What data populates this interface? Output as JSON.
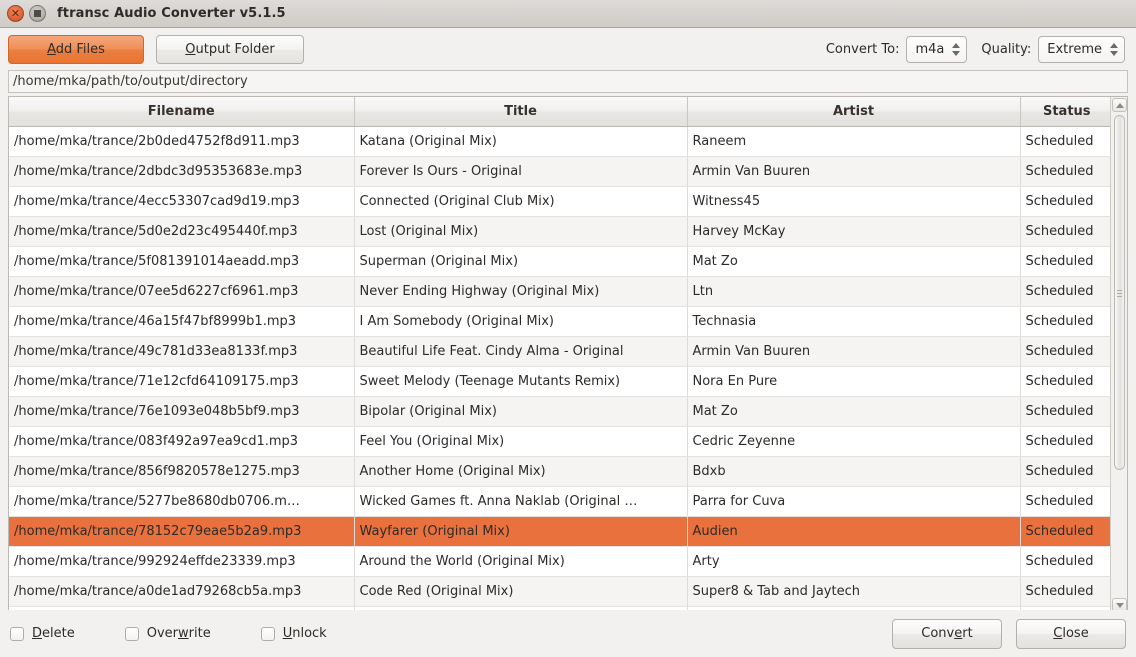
{
  "window": {
    "title": "ftransc Audio Converter v5.1.5",
    "close_icon": "close-icon",
    "maximize_icon": "maximize-icon"
  },
  "toolbar": {
    "add_files": {
      "pre": "A",
      "mnemonic": "A",
      "label": "Add Files",
      "before": "",
      "after": "dd Files"
    },
    "add_files_label": "Add Files",
    "output_folder_label": "Output Folder",
    "convert_to_label": "Convert To:",
    "format_value": "m4a",
    "quality_label": "Quality:",
    "quality_value": "Extreme"
  },
  "path_entry": {
    "value": "/home/mka/path/to/output/directory"
  },
  "table": {
    "columns": [
      "Filename",
      "Title",
      "Artist",
      "Status"
    ],
    "rows": [
      {
        "filename": "/home/mka/trance/2b0ded4752f8d911.mp3",
        "title": "Katana (Original Mix)",
        "artist": "Raneem",
        "status": "Scheduled"
      },
      {
        "filename": "/home/mka/trance/2dbdc3d95353683e.mp3",
        "title": "Forever Is Ours - Original",
        "artist": "Armin Van Buuren",
        "status": "Scheduled"
      },
      {
        "filename": "/home/mka/trance/4ecc53307cad9d19.mp3",
        "title": "Connected (Original Club Mix)",
        "artist": "Witness45",
        "status": "Scheduled"
      },
      {
        "filename": "/home/mka/trance/5d0e2d23c495440f.mp3",
        "title": "Lost (Original Mix)",
        "artist": "Harvey McKay",
        "status": "Scheduled"
      },
      {
        "filename": "/home/mka/trance/5f081391014aeadd.mp3",
        "title": "Superman (Original Mix)",
        "artist": "Mat Zo",
        "status": "Scheduled"
      },
      {
        "filename": "/home/mka/trance/07ee5d6227cf6961.mp3",
        "title": "Never Ending Highway (Original Mix)",
        "artist": "Ltn",
        "status": "Scheduled"
      },
      {
        "filename": "/home/mka/trance/46a15f47bf8999b1.mp3",
        "title": "I Am Somebody (Original Mix)",
        "artist": "Technasia",
        "status": "Scheduled"
      },
      {
        "filename": "/home/mka/trance/49c781d33ea8133f.mp3",
        "title": "Beautiful Life Feat. Cindy Alma - Original",
        "artist": "Armin Van Buuren",
        "status": "Scheduled"
      },
      {
        "filename": "/home/mka/trance/71e12cfd64109175.mp3",
        "title": "Sweet Melody (Teenage Mutants Remix)",
        "artist": "Nora En Pure",
        "status": "Scheduled"
      },
      {
        "filename": "/home/mka/trance/76e1093e048b5bf9.mp3",
        "title": "Bipolar (Original Mix)",
        "artist": "Mat Zo",
        "status": "Scheduled"
      },
      {
        "filename": "/home/mka/trance/083f492a97ea9cd1.mp3",
        "title": "Feel You (Original Mix)",
        "artist": "Cedric Zeyenne",
        "status": "Scheduled"
      },
      {
        "filename": "/home/mka/trance/856f9820578e1275.mp3",
        "title": "Another Home (Original Mix)",
        "artist": "Bdxb",
        "status": "Scheduled"
      },
      {
        "filename": "/home/mka/trance/5277be8680db0706.m…",
        "title": "Wicked Games ft. Anna Naklab (Original …",
        "artist": "Parra for Cuva",
        "status": "Scheduled"
      },
      {
        "filename": "/home/mka/trance/78152c79eae5b2a9.mp3",
        "title": "Wayfarer (Original Mix)",
        "artist": "Audien",
        "status": "Scheduled",
        "selected": true
      },
      {
        "filename": "/home/mka/trance/992924effde23339.mp3",
        "title": "Around the World (Original Mix)",
        "artist": "Arty",
        "status": "Scheduled"
      },
      {
        "filename": "/home/mka/trance/a0de1ad79268cb5a.mp3",
        "title": "Code Red (Original Mix)",
        "artist": "Super8 & Tab and Jaytech",
        "status": "Scheduled"
      }
    ]
  },
  "bottom": {
    "checkboxes": [
      {
        "label": "Delete",
        "checked": false
      },
      {
        "label": "Overwrite",
        "checked": false
      },
      {
        "label": "Unlock",
        "checked": false
      }
    ],
    "convert_label": "Convert",
    "close_label": "Close"
  },
  "colors": {
    "accent": "#e8713d",
    "window_bg": "#f2f1f0",
    "titlebar": "#d5d1cd"
  }
}
